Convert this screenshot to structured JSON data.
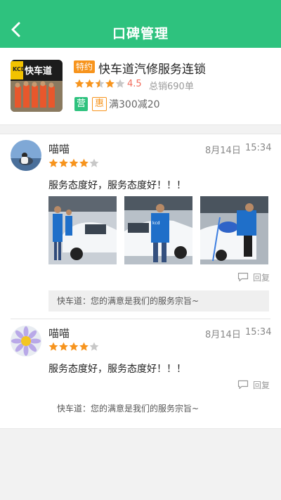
{
  "header": {
    "title": "口碑管理"
  },
  "shop": {
    "special_tag": "特约",
    "name": "快车道汽修服务连锁",
    "rating": "4.5",
    "sales": "总销690单",
    "open_tag": "营",
    "promo_tag": "惠",
    "promo_text": "满300减20",
    "stars_filled": 4.5,
    "stars_total": 5,
    "photo_sign": "快车道"
  },
  "reviews": [
    {
      "name": "喵喵",
      "date": "8月14日",
      "time": "15:34",
      "stars_filled": 4,
      "stars_total": 5,
      "text": "服务态度好，服务态度好！！！",
      "reply_label": "回复",
      "reply": "快车道：您的满意是我们的服务宗旨~"
    },
    {
      "name": "喵喵",
      "date": "8月14日",
      "time": "15:34",
      "stars_filled": 4,
      "stars_total": 5,
      "text": "服务态度好，服务态度好！！！",
      "reply_label": "回复",
      "reply": "快车道：您的满意是我们的服务宗旨~"
    }
  ],
  "colors": {
    "brand_green": "#2ec27e",
    "star_orange": "#f7941d",
    "score_red": "#f26b5b"
  }
}
